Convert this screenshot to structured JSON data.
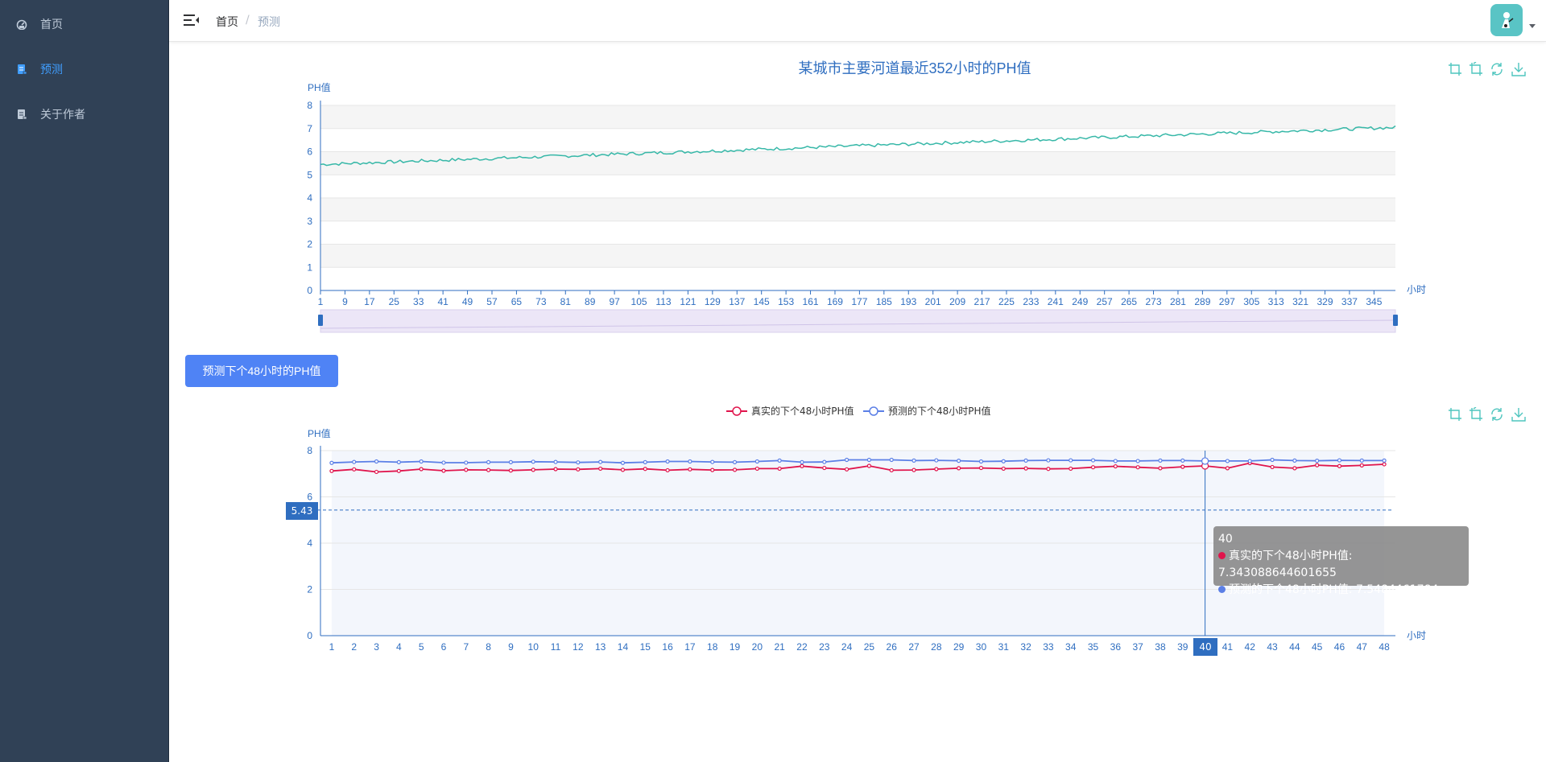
{
  "sidebar": {
    "items": [
      {
        "label": "首页",
        "icon": "dashboard-icon",
        "active": false
      },
      {
        "label": "预测",
        "icon": "document-icon",
        "active": true
      },
      {
        "label": "关于作者",
        "icon": "document-icon",
        "active": false
      }
    ]
  },
  "navbar": {
    "breadcrumb_home": "首页",
    "breadcrumb_sep": "/",
    "breadcrumb_current": "预测"
  },
  "predict_button": "预测下个48小时的PH值",
  "chart1": {
    "title": "某城市主要河道最近352小时的PH值",
    "ylabel": "PH值",
    "xlabel": "小时"
  },
  "chart2": {
    "ylabel": "PH值",
    "xlabel": "小时",
    "legend": [
      "真实的下个48小时PH值",
      "预测的下个48小时PH值"
    ],
    "mark_line_value": "5.43",
    "highlight_x": "40",
    "tooltip": {
      "title": "40",
      "line1": "真实的下个48小时PH值: 7.343088644601655",
      "line2": "预测的下个48小时PH值: 7.5484461784"
    }
  },
  "colors": {
    "sidebar_bg": "#304156",
    "active": "#409eff",
    "line1": "#37b8a8",
    "real": "#e0144c",
    "pred": "#5b7fe6",
    "axis": "#2f6ec0",
    "toolbox": "#4ec5be"
  },
  "chart_data": [
    {
      "type": "line",
      "title": "某城市主要河道最近352小时的PH值",
      "xlabel": "小时",
      "ylabel": "PH值",
      "ylim": [
        0,
        8
      ],
      "x_range": [
        1,
        352
      ],
      "x_tick_labels": [
        1,
        9,
        17,
        25,
        33,
        41,
        49,
        57,
        65,
        73,
        81,
        89,
        97,
        105,
        113,
        121,
        129,
        137,
        145,
        153,
        161,
        169,
        177,
        185,
        193,
        201,
        209,
        217,
        225,
        233,
        241,
        249,
        257,
        265,
        273,
        281,
        289,
        297,
        305,
        313,
        321,
        329,
        337,
        345
      ],
      "y_tick_labels": [
        0,
        1,
        2,
        3,
        4,
        5,
        6,
        7,
        8
      ],
      "grid": true,
      "series": [
        {
          "values_start": 5.45,
          "values_end": 7.05,
          "trend": "linear increasing with small noise"
        }
      ]
    },
    {
      "type": "line",
      "xlabel": "小时",
      "ylabel": "PH值",
      "ylim": [
        0,
        8
      ],
      "y_tick_labels": [
        0,
        2,
        4,
        6,
        8
      ],
      "categories": [
        1,
        2,
        3,
        4,
        5,
        6,
        7,
        8,
        9,
        10,
        11,
        12,
        13,
        14,
        15,
        16,
        17,
        18,
        19,
        20,
        21,
        22,
        23,
        24,
        25,
        26,
        27,
        28,
        29,
        30,
        31,
        32,
        33,
        34,
        35,
        36,
        37,
        38,
        39,
        40,
        41,
        42,
        43,
        44,
        45,
        46,
        47,
        48
      ],
      "legend_position": "top-center",
      "series": [
        {
          "name": "真实的下个48小时PH值",
          "values": [
            7.12,
            7.19,
            7.08,
            7.12,
            7.2,
            7.13,
            7.17,
            7.16,
            7.14,
            7.17,
            7.2,
            7.19,
            7.22,
            7.17,
            7.21,
            7.15,
            7.19,
            7.16,
            7.17,
            7.22,
            7.22,
            7.33,
            7.25,
            7.19,
            7.34,
            7.15,
            7.16,
            7.2,
            7.24,
            7.25,
            7.22,
            7.23,
            7.21,
            7.22,
            7.28,
            7.32,
            7.28,
            7.24,
            7.3,
            7.34,
            7.24,
            7.46,
            7.29,
            7.24,
            7.37,
            7.33,
            7.36,
            7.41
          ]
        },
        {
          "name": "预测的下个48小时PH值",
          "values": [
            7.47,
            7.51,
            7.53,
            7.5,
            7.53,
            7.48,
            7.48,
            7.5,
            7.5,
            7.52,
            7.51,
            7.49,
            7.51,
            7.47,
            7.5,
            7.53,
            7.53,
            7.51,
            7.5,
            7.53,
            7.57,
            7.5,
            7.51,
            7.6,
            7.6,
            7.6,
            7.57,
            7.58,
            7.56,
            7.53,
            7.54,
            7.57,
            7.58,
            7.58,
            7.58,
            7.55,
            7.55,
            7.57,
            7.57,
            7.55,
            7.55,
            7.55,
            7.6,
            7.57,
            7.56,
            7.58,
            7.57,
            7.57
          ]
        }
      ],
      "mark_line": 5.43,
      "tooltip_x": 40
    }
  ]
}
